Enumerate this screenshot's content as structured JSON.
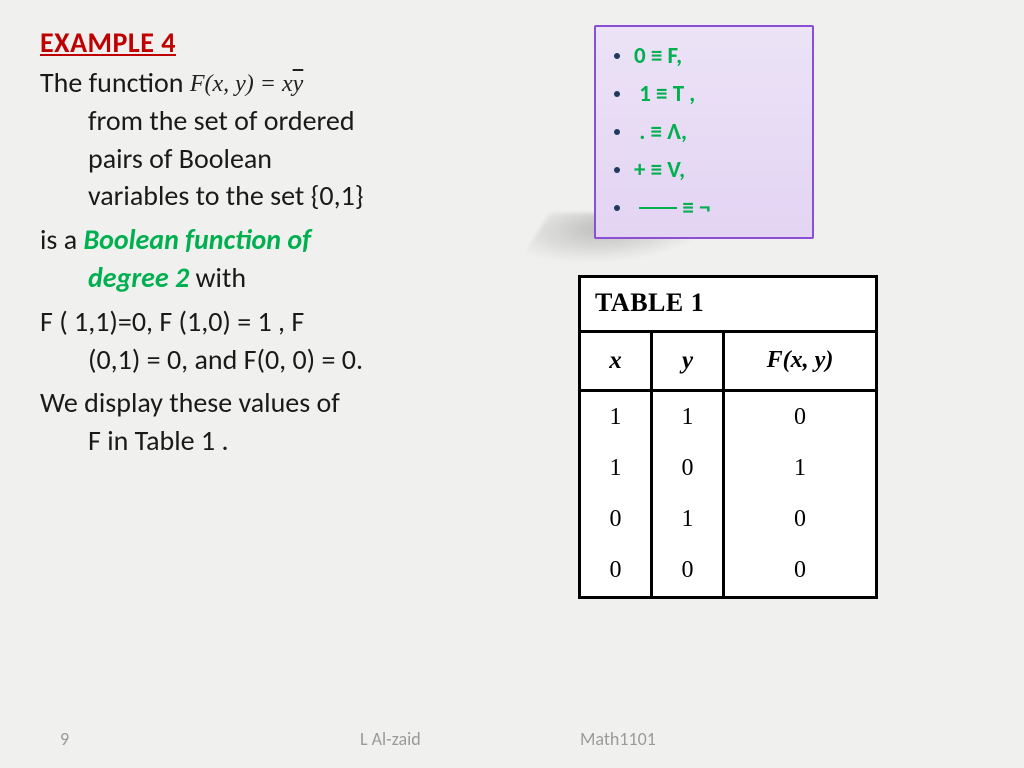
{
  "heading": "EXAMPLE 4",
  "body": {
    "line1_lead": "The function ",
    "formula": "F(x, y) = x",
    "formula_ybar": "y",
    "line1_rest_a": "from the set of ordered",
    "line1_rest_b": "pairs of Boolean",
    "line1_rest_c": "variables to the set {0,1}",
    "line2_a": "is a ",
    "line2_green": "Boolean function of",
    "line2_green_b": "degree 2",
    "line2_b": " with",
    "line3_a": "F ( 1,1)=0, F (1,0) = 1 , F",
    "line3_b": "(0,1) = 0, and F(0, 0) = 0.",
    "line4_a": "We display these values of",
    "line4_b": "F in Table 1 ."
  },
  "legend": {
    "items": [
      "0 ≡ F,",
      " 1 ≡ T ,",
      " . ≡ Λ,",
      "+ ≡ V,",
      "  ___ ≡ ¬"
    ]
  },
  "table": {
    "title": "TABLE 1",
    "headers": [
      "x",
      "y",
      "F(x, y)"
    ],
    "rows": [
      [
        "1",
        "1",
        "0"
      ],
      [
        "1",
        "0",
        "1"
      ],
      [
        "0",
        "1",
        "0"
      ],
      [
        "0",
        "0",
        "0"
      ]
    ]
  },
  "footer": {
    "page": "9",
    "author": "L Al-zaid",
    "course": "Math1101"
  },
  "chart_data": {
    "type": "table",
    "title": "TABLE 1",
    "columns": [
      "x",
      "y",
      "F(x, y)"
    ],
    "rows": [
      [
        1,
        1,
        0
      ],
      [
        1,
        0,
        1
      ],
      [
        0,
        1,
        0
      ],
      [
        0,
        0,
        0
      ]
    ]
  }
}
